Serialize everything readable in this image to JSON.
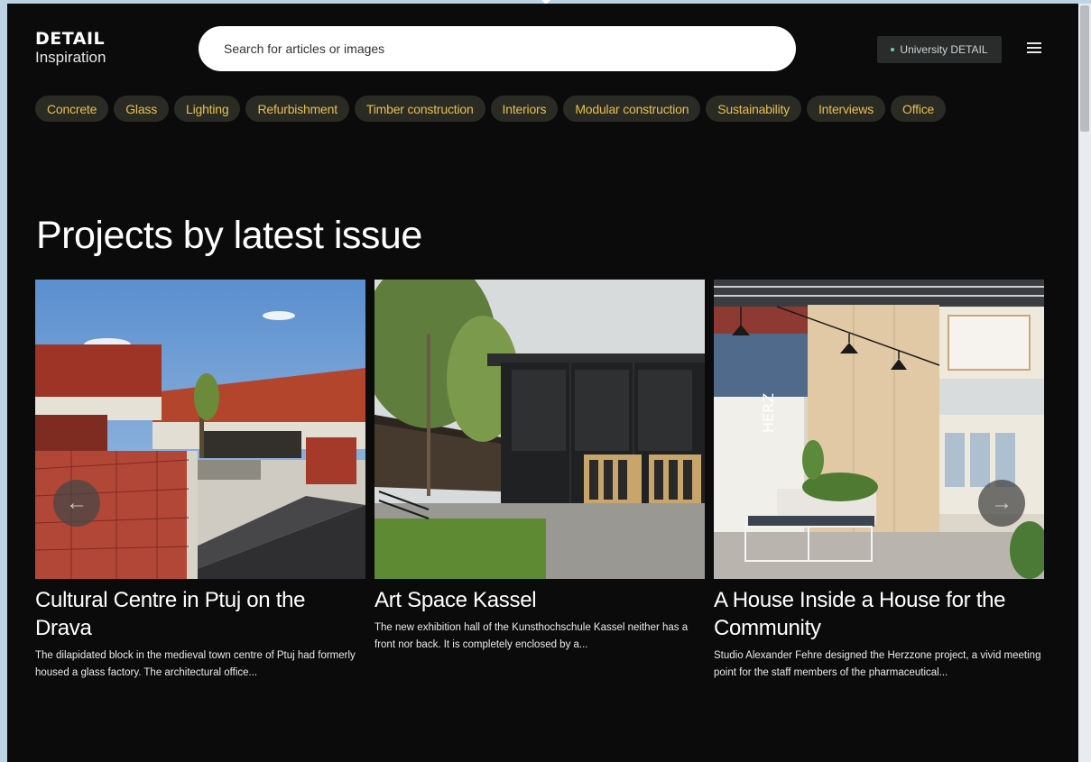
{
  "brand": {
    "line1": "DETAIL",
    "line2": "Inspiration"
  },
  "search": {
    "placeholder": "Search for articles or images"
  },
  "header": {
    "university_label": "University DETAIL",
    "menu_icon": "hamburger-menu-icon"
  },
  "tags": [
    "Concrete",
    "Glass",
    "Lighting",
    "Refurbishment",
    "Timber construction",
    "Interiors",
    "Modular construction",
    "Sustainability",
    "Interviews",
    "Office"
  ],
  "section": {
    "title": "Projects by latest issue"
  },
  "cards": [
    {
      "title": "Cultural Centre in Ptuj on the Drava",
      "excerpt": "The dilapidated block in the medieval town centre of Ptuj had formerly housed a glass factory. The architectural office..."
    },
    {
      "title": "Art Space Kassel",
      "excerpt": "The new exhibition hall of the Kunsthochschule Kassel neither has a front nor back. It is completely enclosed by a..."
    },
    {
      "title": "A House Inside a House for the Community",
      "excerpt": "Studio Alexander Fehre designed the Herzzone project, a vivid meeting point for the staff members of the pharmaceutical..."
    }
  ],
  "carousel": {
    "prev_icon": "arrow-left-icon",
    "next_icon": "arrow-right-icon"
  },
  "colors": {
    "background": "#0b0b0b",
    "tag_text": "#e8bf4a",
    "tag_bg": "#2b2b26",
    "accent_dot": "#6fd19b"
  }
}
